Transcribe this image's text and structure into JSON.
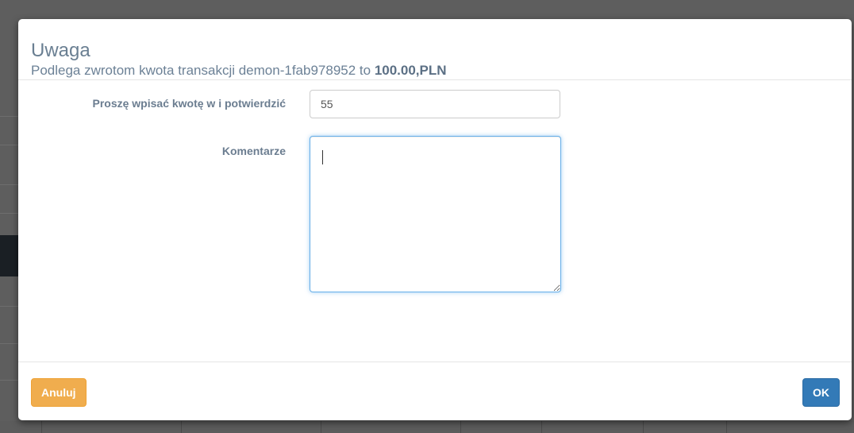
{
  "modal": {
    "title": "Uwaga",
    "info": {
      "prefix": "Podlega zwrotom kwota transakcji demon-1fab978952 to ",
      "amount": "100.00,PLN"
    },
    "form": {
      "amount_label": "Proszę wpisać kwotę w i potwierdzić",
      "amount_value": "55",
      "comment_label": "Komentarze",
      "comment_value": ""
    },
    "buttons": {
      "cancel_label": "Anuluj",
      "ok_label": "OK"
    }
  },
  "colors": {
    "cancel": "#f0ad4e",
    "ok": "#337ab7",
    "title": "#6a7f92"
  }
}
